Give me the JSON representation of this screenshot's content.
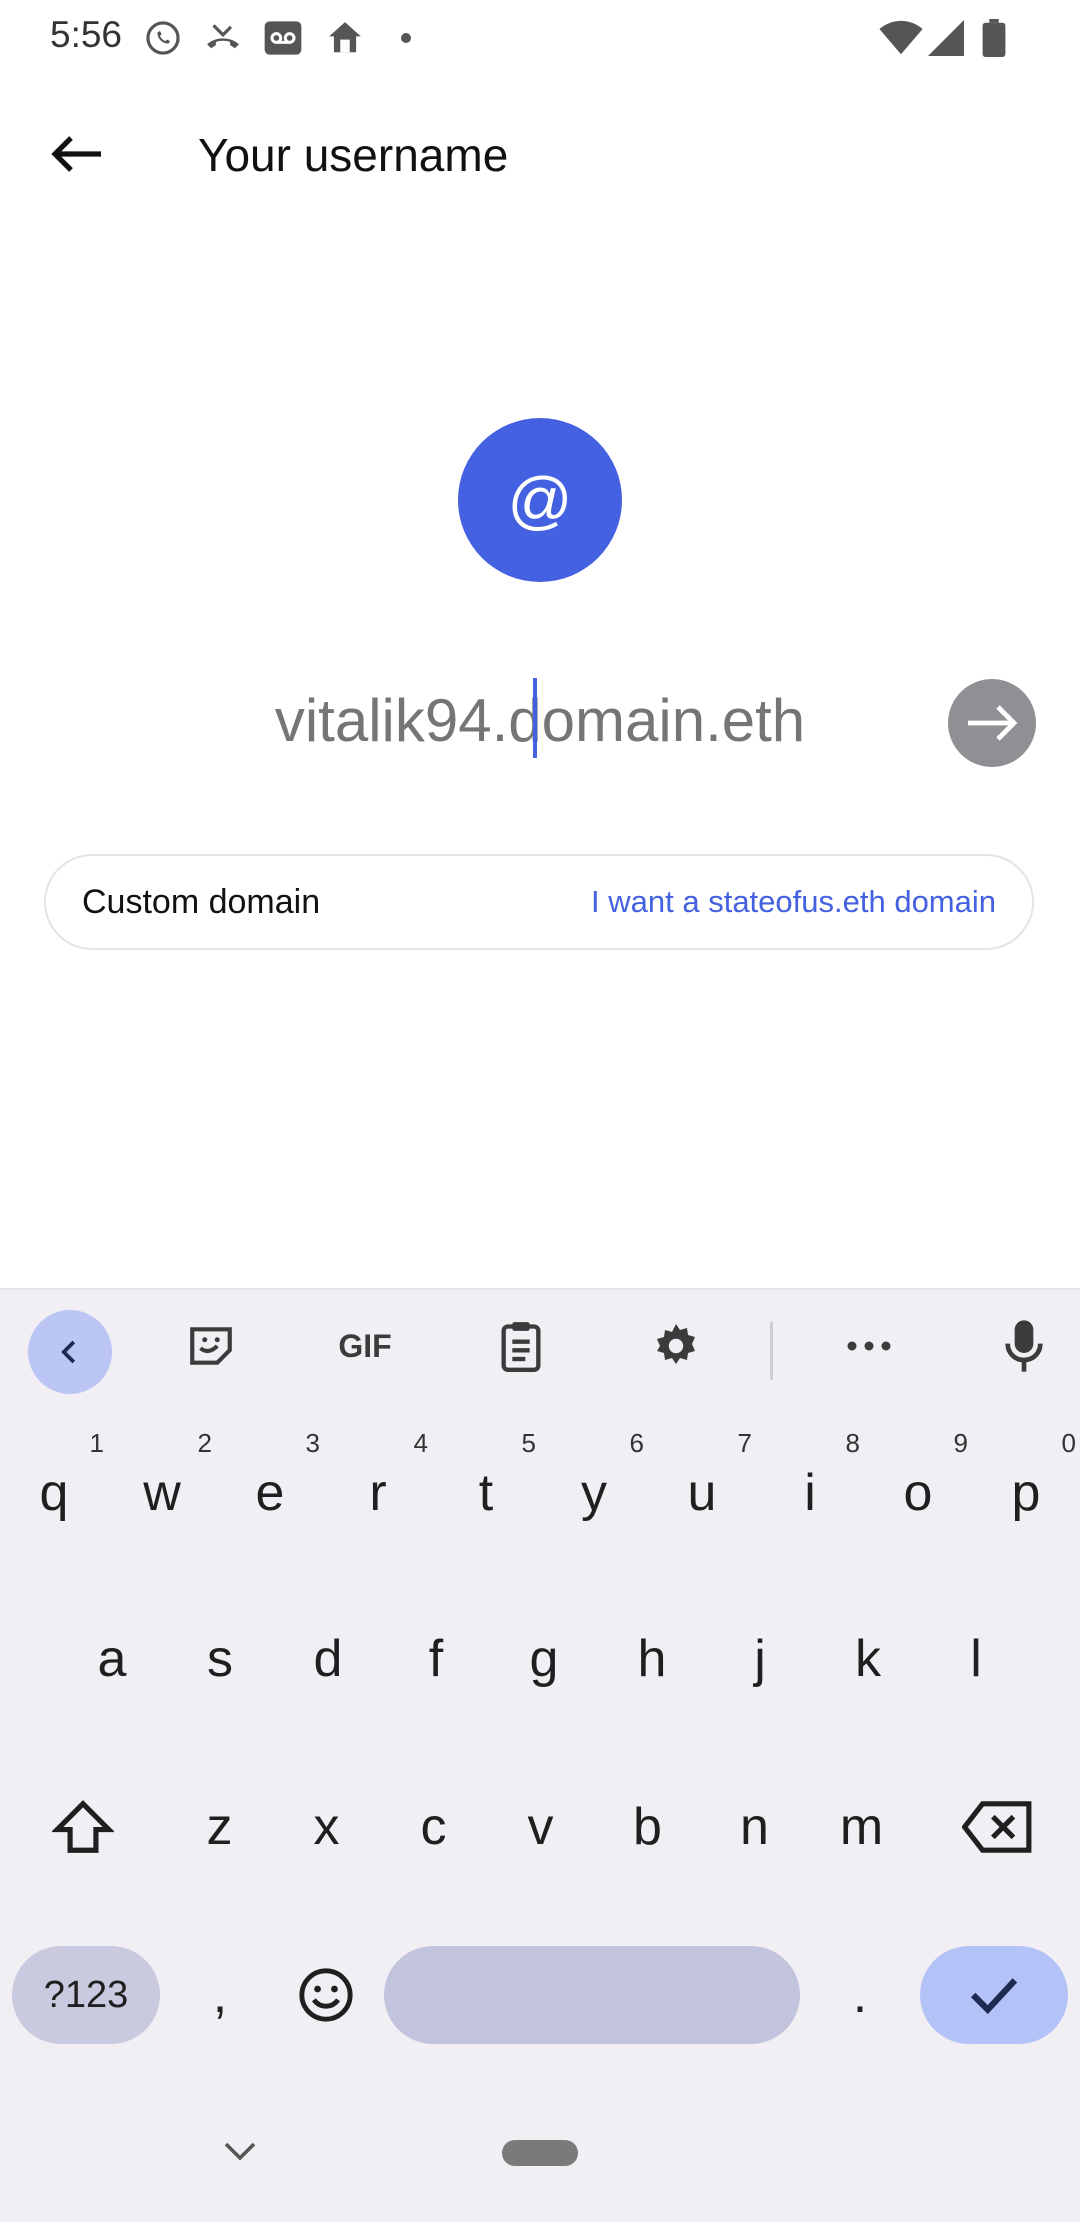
{
  "status_bar": {
    "time": "5:56"
  },
  "app_bar": {
    "title": "Your username"
  },
  "avatar": {
    "symbol": "@"
  },
  "username_field": {
    "placeholder": "vitalik94.domain.eth",
    "value": ""
  },
  "custom_domain": {
    "label": "Custom domain",
    "link": "I want a stateofus.eth domain"
  },
  "keyboard": {
    "toolbar": {
      "gif_label": "GIF"
    },
    "row1": [
      {
        "key": "q",
        "hint": "1"
      },
      {
        "key": "w",
        "hint": "2"
      },
      {
        "key": "e",
        "hint": "3"
      },
      {
        "key": "r",
        "hint": "4"
      },
      {
        "key": "t",
        "hint": "5"
      },
      {
        "key": "y",
        "hint": "6"
      },
      {
        "key": "u",
        "hint": "7"
      },
      {
        "key": "i",
        "hint": "8"
      },
      {
        "key": "o",
        "hint": "9"
      },
      {
        "key": "p",
        "hint": "0"
      }
    ],
    "row2": [
      "a",
      "s",
      "d",
      "f",
      "g",
      "h",
      "j",
      "k",
      "l"
    ],
    "row3": [
      "z",
      "x",
      "c",
      "v",
      "b",
      "n",
      "m"
    ],
    "symbols_label": "?123",
    "comma": ",",
    "period": "."
  },
  "colors": {
    "accent": "#4361e0",
    "keyboard_bg": "#f1eff4",
    "space_key": "#c2c4dd",
    "enter_key": "#b4c3f7"
  }
}
